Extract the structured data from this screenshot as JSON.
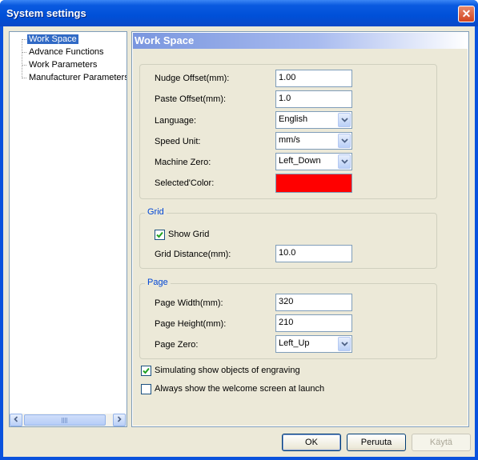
{
  "window": {
    "title": "System settings"
  },
  "tree": {
    "items": [
      {
        "label": "Work Space",
        "selected": true
      },
      {
        "label": "Advance Functions",
        "selected": false
      },
      {
        "label": "Work Parameters",
        "selected": false
      },
      {
        "label": "Manufacturer Parameters",
        "selected": false
      }
    ]
  },
  "panel": {
    "header": "Work Space",
    "general": {
      "nudge_offset": {
        "label": "Nudge Offset(mm):",
        "value": "1.00"
      },
      "paste_offset": {
        "label": "Paste Offset(mm):",
        "value": "1.0"
      },
      "language": {
        "label": "Language:",
        "value": "English"
      },
      "speed_unit": {
        "label": "Speed Unit:",
        "value": "mm/s"
      },
      "machine_zero": {
        "label": "Machine Zero:",
        "value": "Left_Down"
      },
      "selected_color": {
        "label": "Selected'Color:",
        "color": "#ff0000"
      }
    },
    "grid": {
      "title": "Grid",
      "show_grid": {
        "label": "Show Grid",
        "checked": true
      },
      "distance": {
        "label": "Grid Distance(mm):",
        "value": "10.0"
      }
    },
    "page": {
      "title": "Page",
      "width": {
        "label": "Page Width(mm):",
        "value": "320"
      },
      "height": {
        "label": "Page Height(mm):",
        "value": "210"
      },
      "zero": {
        "label": "Page Zero:",
        "value": "Left_Up"
      }
    },
    "simulating": {
      "label": "Simulating show objects of engraving",
      "checked": true
    },
    "welcome": {
      "label": "Always show the welcome screen at launch",
      "checked": false
    }
  },
  "buttons": {
    "ok": "OK",
    "cancel": "Peruuta",
    "apply": "Käytä"
  },
  "colors": {
    "titlebar": "#0a5ae0",
    "selection": "#316ac5",
    "group_title": "#0046d5"
  }
}
